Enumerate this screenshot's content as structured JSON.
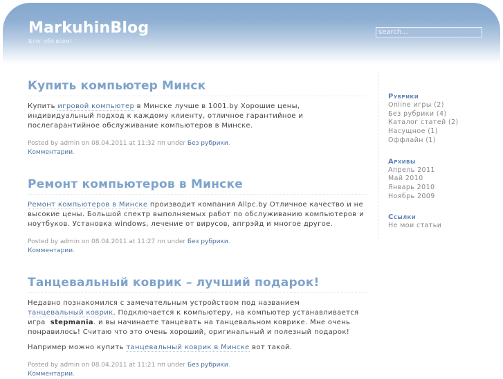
{
  "header": {
    "title": "MarkuhinBlog",
    "tagline": "Блог обо всем!",
    "search_placeholder": "search..."
  },
  "posts": [
    {
      "title": "Купить компьютер Минск",
      "paragraphs": [
        {
          "t1": "Купить ",
          "link": "игровой компьютер",
          "t2": " в Минске лучше в 1001.by Хорошие цены, индивидуальный подход к каждому клиенту, отличное гарантийное и послегарантийное обслуживание компьютеров в Минске."
        }
      ],
      "meta": "Posted by admin on 08.04.2011 at 11:32 пп under ",
      "category": "Без рубрики",
      "comments": "Комментарии"
    },
    {
      "title": "Ремонт компьютеров в Минске",
      "paragraphs": [
        {
          "t1": "",
          "link": "Ремонт компьютеров в Минске",
          "t2": "  производит компания  Allpc.by Отличное качество и не высокие цены. Большой спектр выполняемых работ по обслуживанию компьютеров и ноутбуков. Установка windows, лечение от вирусов, апгрэйд и многое другое."
        }
      ],
      "meta": "Posted by admin on 08.04.2011 at 11:27 пп under ",
      "category": "Без рубрики",
      "comments": "Комментарии"
    },
    {
      "title": "Танцевальный коврик – лучший подарок!",
      "paragraphs": [
        {
          "t1": "Недавно познакомился с замечательным устройством под названием        ",
          "link": "танцевальный коврик",
          "t2": ". Подключается к компьютеру, на компьютер устанавливается игра  ",
          "bold": "stepmania",
          "t3": ". и вы начинаете танцевать на танцевальном коврике. Мне очень понравилось! Считаю что это очень хороший, оригинальный и полезный подарок!"
        },
        {
          "t1": "Например можно купить ",
          "link": "танцевальный коврик в Минске",
          "t2": " вот такой."
        }
      ],
      "meta": "Posted by admin on 08.04.2011 at 11:21 пп under ",
      "category": "Без рубрики",
      "comments": "Комментарии"
    }
  ],
  "sidebar": {
    "categories": {
      "title": "Рубрики",
      "items": [
        "Online игры (2)",
        "Без рубрики (4)",
        "Каталог статей (2)",
        "Насущное (1)",
        "Оффлайн (1)"
      ]
    },
    "archives": {
      "title": "Архивы",
      "items": [
        "Апрель 2011",
        "Май 2010",
        "Январь 2010",
        "Ноябрь 2009"
      ]
    },
    "links": {
      "title": "Ссылки",
      "items": [
        "Не мои статьи"
      ]
    }
  }
}
